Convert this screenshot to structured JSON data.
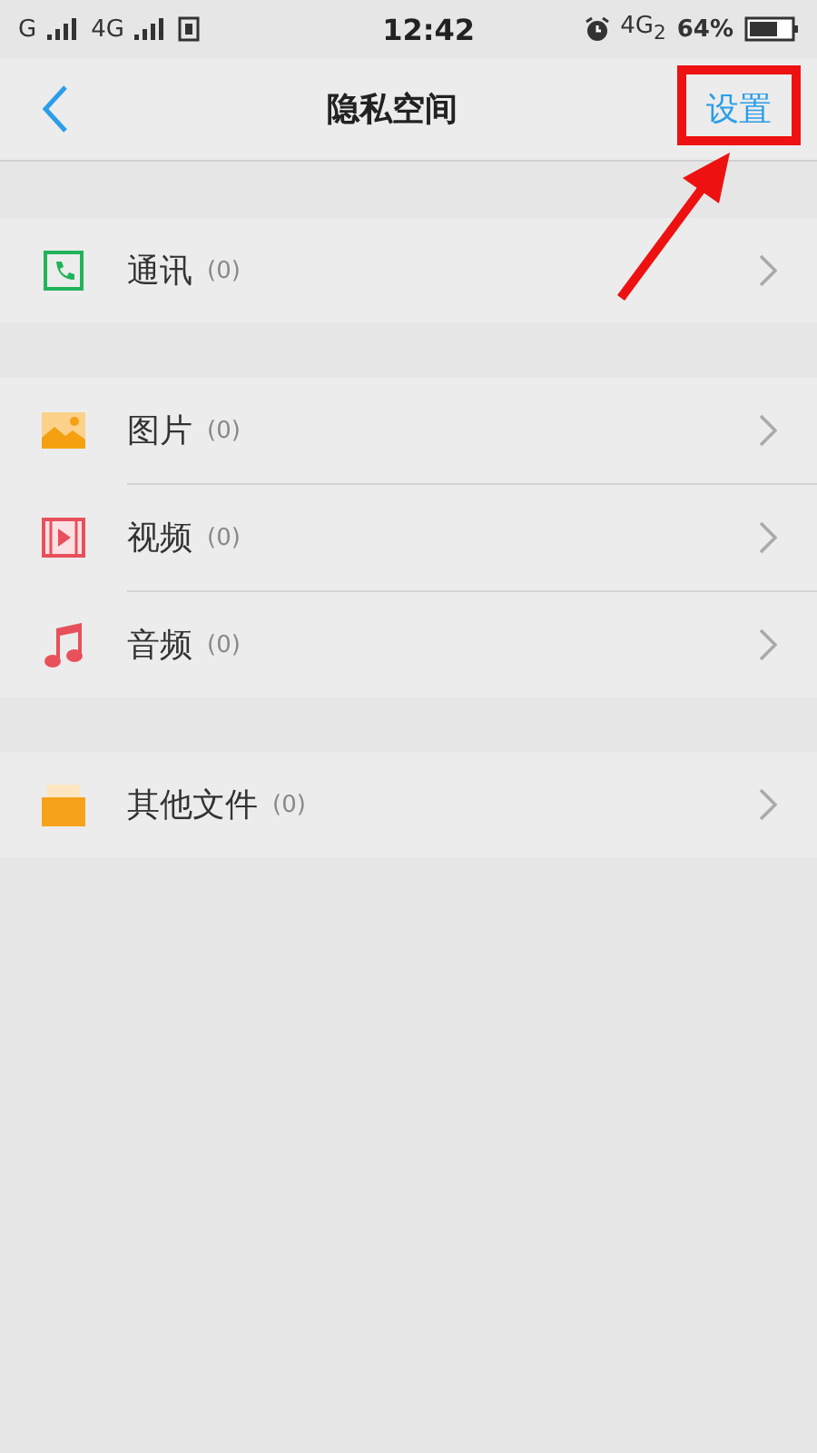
{
  "status_bar": {
    "left": [
      "G",
      "4G"
    ],
    "time": "12:42",
    "network": "4G$_{2}$",
    "battery": "64%"
  },
  "header": {
    "title": "隐私空间",
    "action": "设置"
  },
  "groups": [
    {
      "items": [
        {
          "kind": "contacts",
          "label": "通讯",
          "count": "(0)"
        }
      ]
    },
    {
      "items": [
        {
          "kind": "image",
          "label": "图片",
          "count": "(0)"
        },
        {
          "kind": "video",
          "label": "视频",
          "count": "(0)"
        },
        {
          "kind": "music",
          "label": "音频",
          "count": "(0)"
        }
      ]
    },
    {
      "items": [
        {
          "kind": "folder",
          "label": "其他文件",
          "count": "(0)"
        }
      ]
    }
  ]
}
